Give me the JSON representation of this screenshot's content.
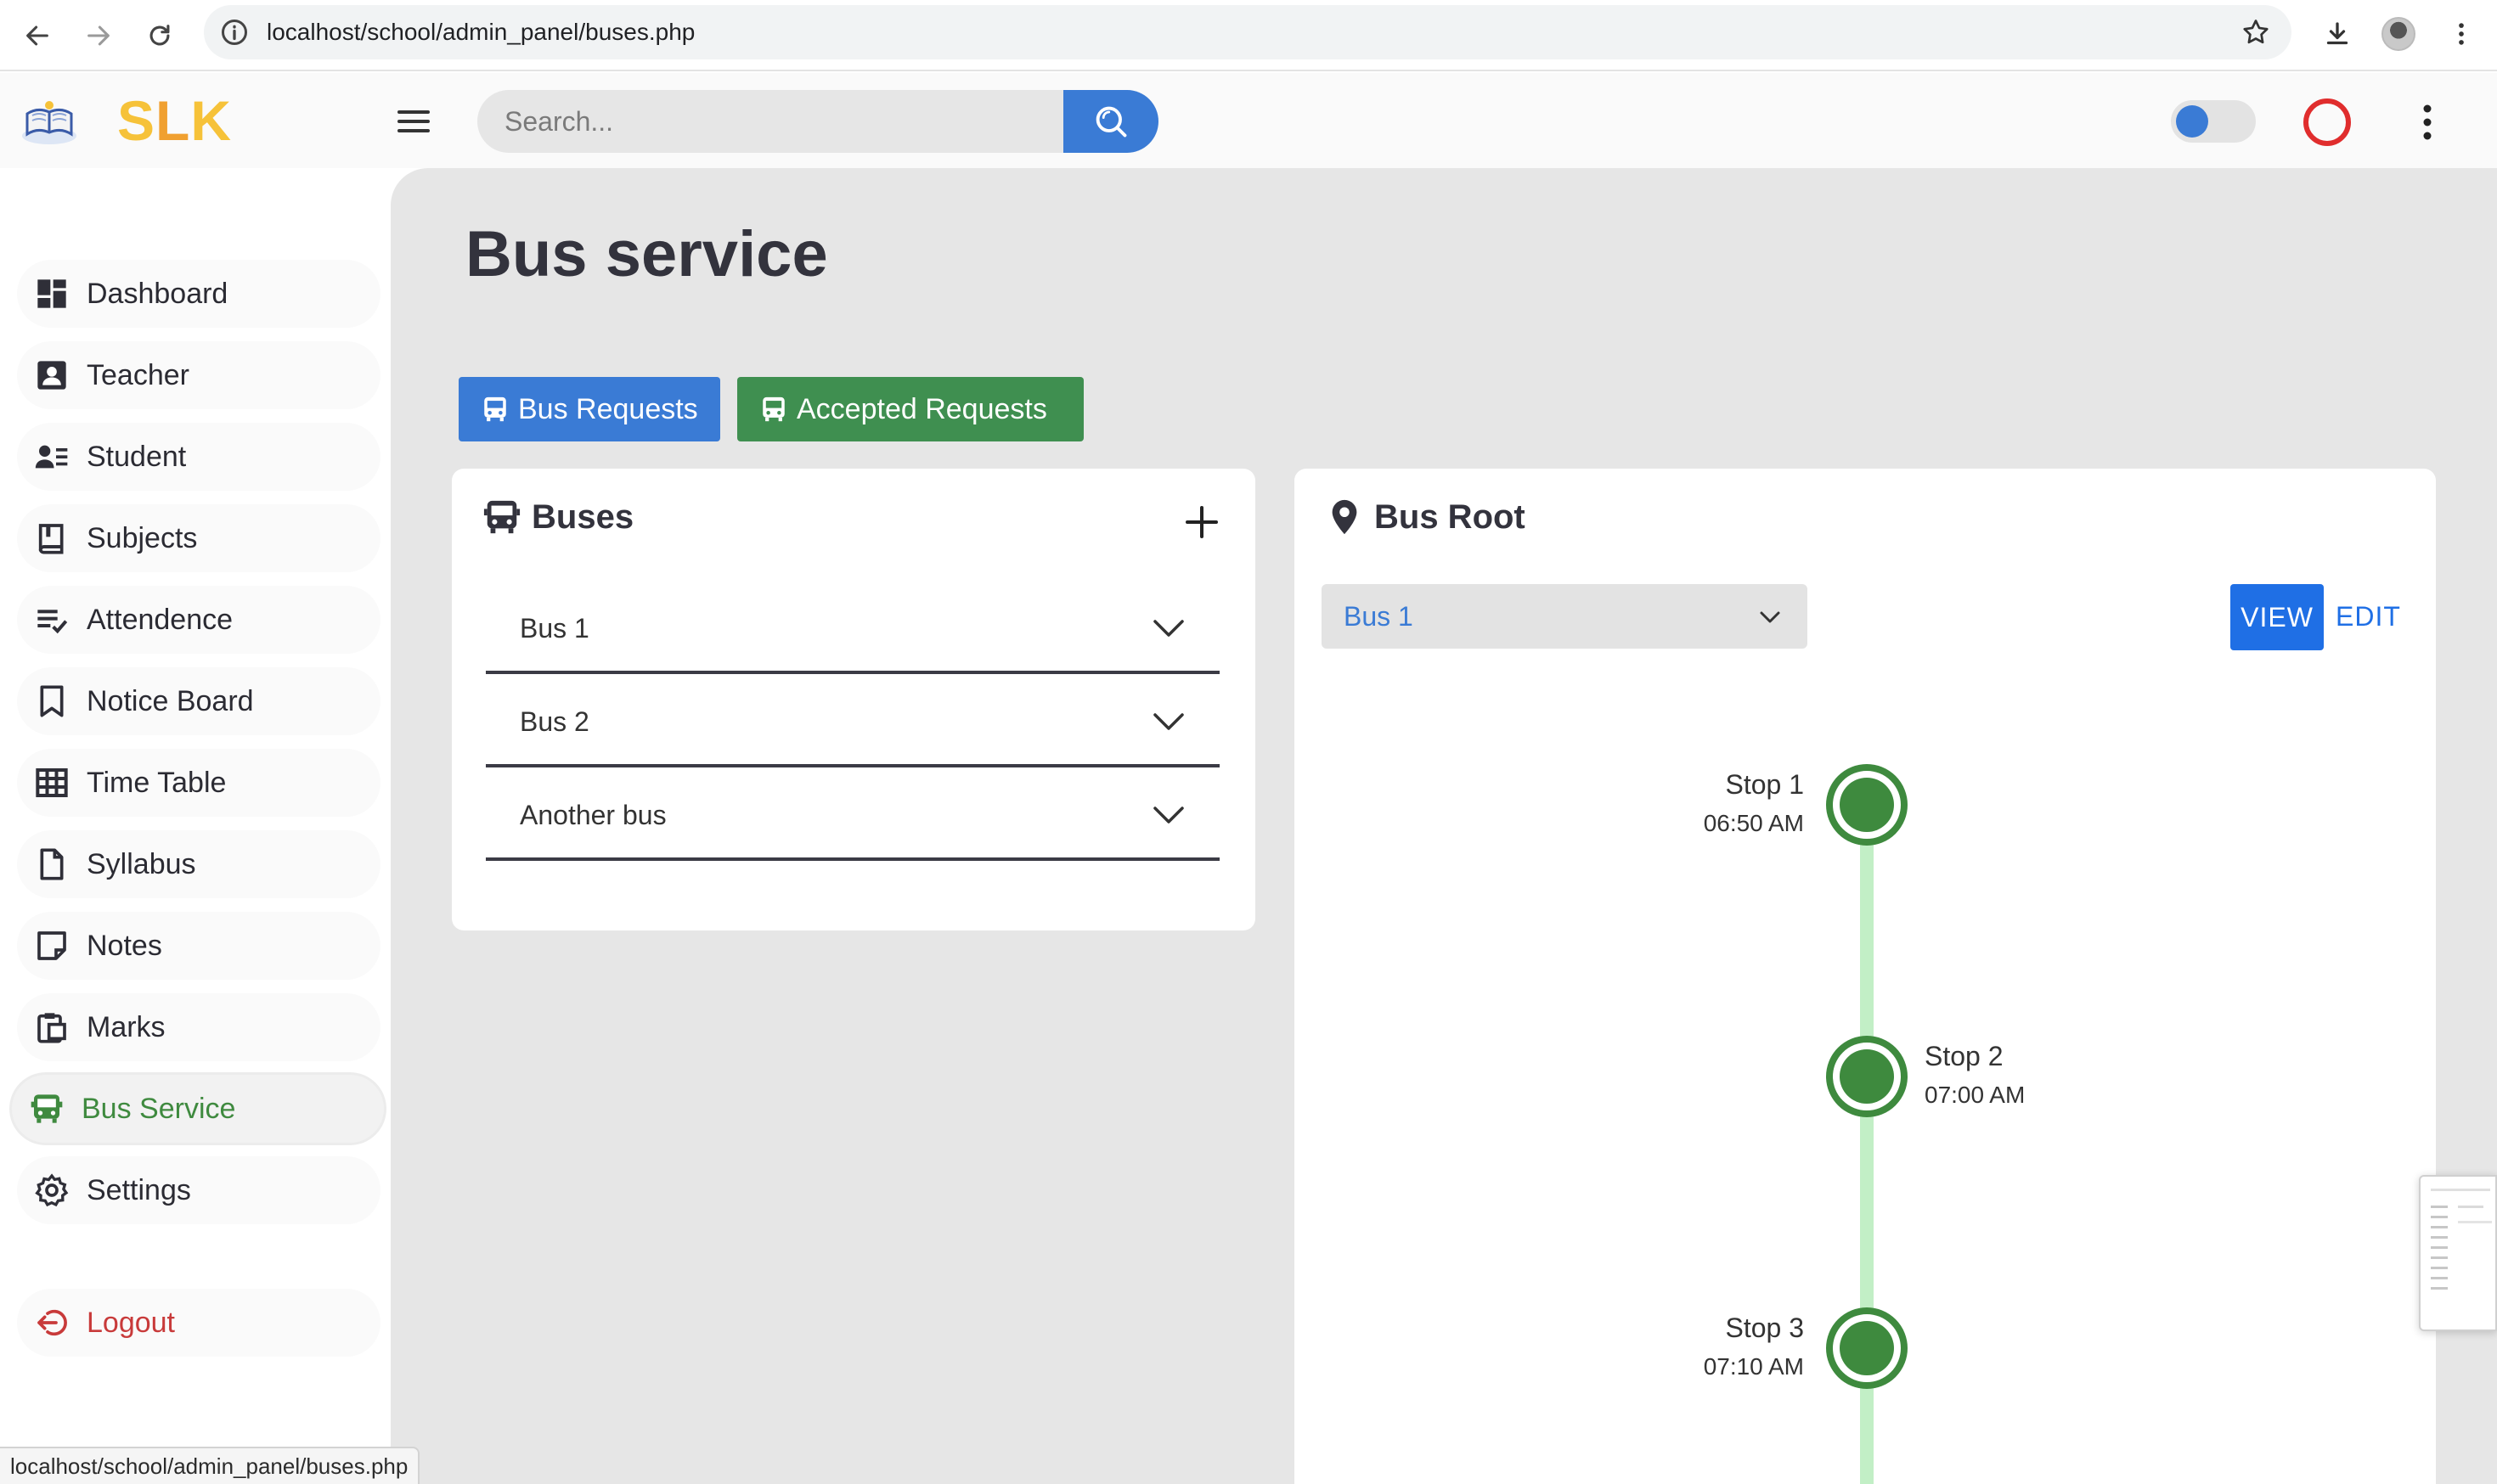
{
  "browser": {
    "url": "localhost/school/admin_panel/buses.php"
  },
  "header": {
    "logo_text_s": "S",
    "logo_text_l": "L",
    "logo_text_k": "K",
    "search_placeholder": "Search..."
  },
  "sidebar": {
    "items": [
      {
        "label": "Dashboard",
        "icon": "dashboard-icon"
      },
      {
        "label": "Teacher",
        "icon": "teacher-icon"
      },
      {
        "label": "Student",
        "icon": "student-icon"
      },
      {
        "label": "Subjects",
        "icon": "book-icon"
      },
      {
        "label": "Attendence",
        "icon": "checklist-icon"
      },
      {
        "label": "Notice Board",
        "icon": "bookmark-icon"
      },
      {
        "label": "Time Table",
        "icon": "table-icon"
      },
      {
        "label": "Syllabus",
        "icon": "document-icon"
      },
      {
        "label": "Notes",
        "icon": "sticky-note-icon"
      },
      {
        "label": "Marks",
        "icon": "clipboard-icon"
      },
      {
        "label": "Bus Service",
        "icon": "bus-icon",
        "active": true
      },
      {
        "label": "Settings",
        "icon": "gear-icon"
      }
    ],
    "logout": "Logout"
  },
  "main": {
    "title": "Bus service",
    "tabs": {
      "requests": "Bus Requests",
      "accepted": "Accepted Requests"
    },
    "buses_card": {
      "title": "Buses",
      "buses": [
        "Bus 1",
        "Bus 2",
        "Another bus"
      ]
    },
    "root_card": {
      "title": "Bus Root",
      "selected_bus": "Bus 1",
      "view_label": "VIEW",
      "edit_label": "EDIT",
      "stops": [
        {
          "name": "Stop 1",
          "time": "06:50 AM",
          "side": "left"
        },
        {
          "name": "Stop 2",
          "time": "07:00 AM",
          "side": "right"
        },
        {
          "name": "Stop 3",
          "time": "07:10 AM",
          "side": "left"
        }
      ]
    }
  },
  "status_bar": {
    "url": "localhost/school/admin_panel/buses.php"
  },
  "colors": {
    "primary_blue": "#3a7bd5",
    "success_green": "#3f8f50",
    "timeline_green": "#3e8a3e",
    "logout_red": "#c83a3a",
    "logo_yellow": "#f6c239"
  }
}
